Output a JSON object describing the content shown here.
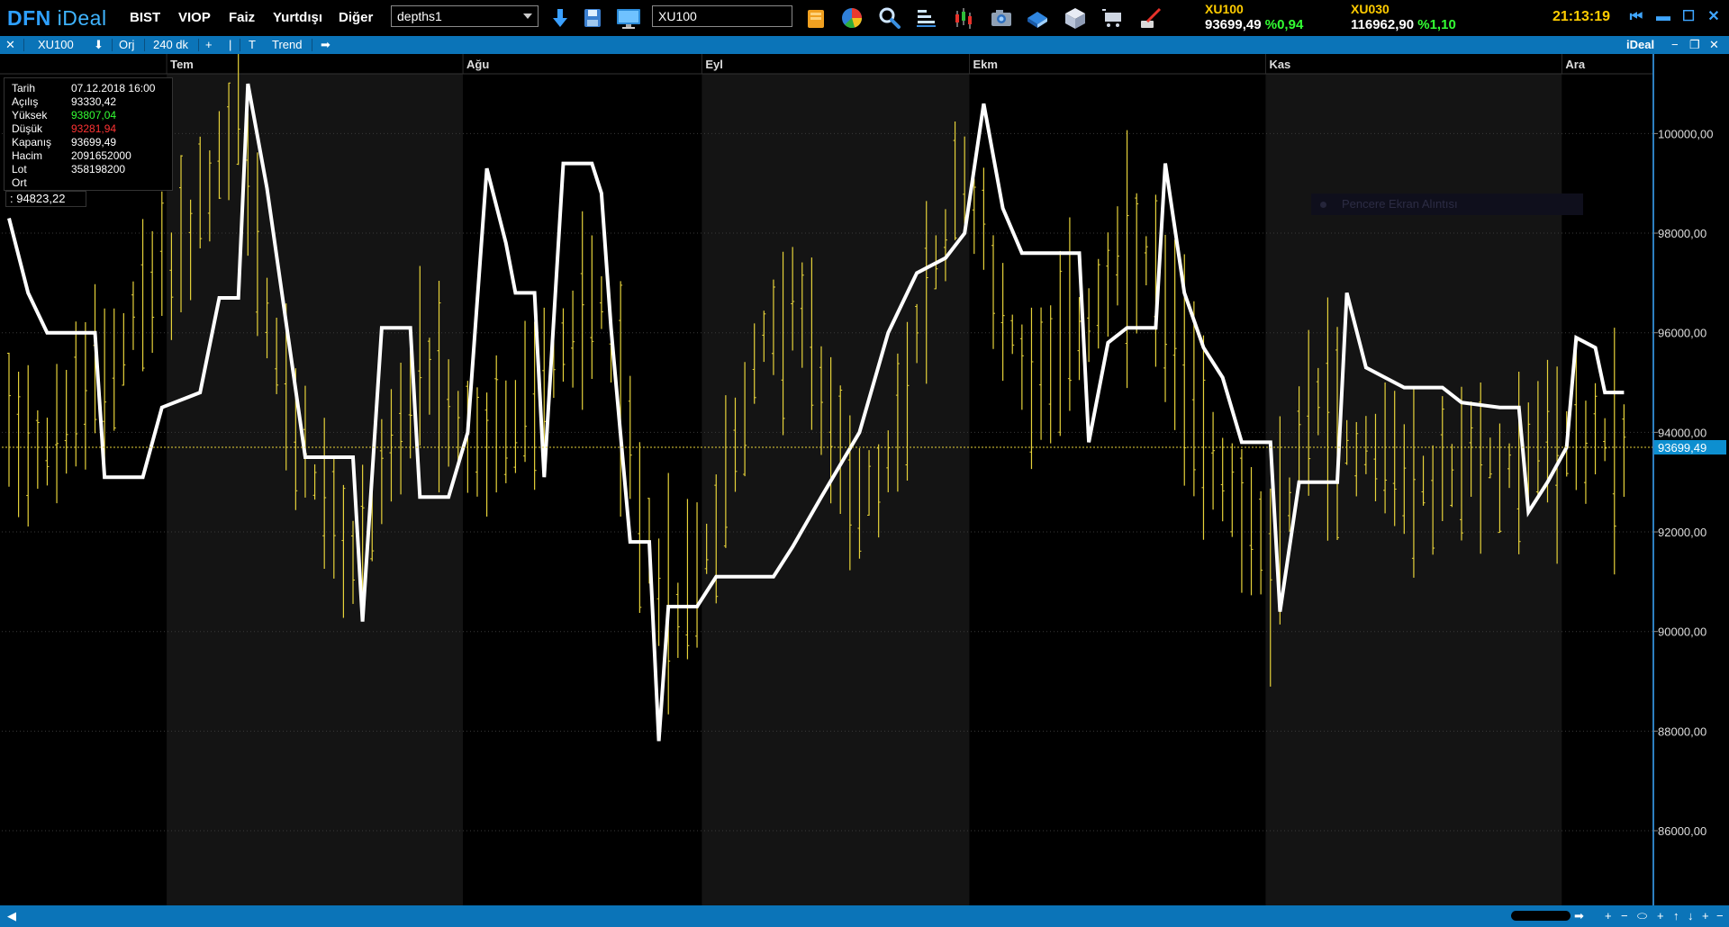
{
  "app": {
    "logo_main": "DFN",
    "logo_sub": "iDeal"
  },
  "menu": [
    {
      "id": "bist",
      "label": "BIST"
    },
    {
      "id": "viop",
      "label": "VIOP"
    },
    {
      "id": "faiz",
      "label": "Faiz"
    },
    {
      "id": "yurtdisi",
      "label": "Yurtdışı"
    },
    {
      "id": "diger",
      "label": "Diğer"
    }
  ],
  "toolbar": {
    "depth_select": "depths1",
    "symbol_input": "XU100"
  },
  "icons": [
    "download-arrow-icon",
    "save-disk-icon",
    "monitor-icon",
    "folder-icon",
    "pie-chart-icon",
    "magnifier-icon",
    "bar-list-icon",
    "candlestick-icon",
    "camera-icon",
    "book-icon",
    "cube-icon",
    "cart-icon",
    "brush-icon"
  ],
  "quotes": [
    {
      "name": "XU100",
      "value": "93699,49",
      "change": "%0,94"
    },
    {
      "name": "XU030",
      "value": "116962,90",
      "change": "%1,10"
    }
  ],
  "clock": "21:13:19",
  "chart_tab": {
    "symbol": "XU100",
    "mode": "Orj",
    "period": "240 dk",
    "tool": "Trend",
    "brand": "iDeal"
  },
  "info": {
    "rows": [
      {
        "label": "Tarih",
        "value": "07.12.2018 16:00",
        "color": "#ffffff"
      },
      {
        "label": "Açılış",
        "value": "93330,42",
        "color": "#ffffff"
      },
      {
        "label": "Yüksek",
        "value": "93807,04",
        "color": "#33ff33"
      },
      {
        "label": "Düşük",
        "value": "93281,94",
        "color": "#ff3333"
      },
      {
        "label": "Kapanış",
        "value": "93699,49",
        "color": "#ffffff"
      },
      {
        "label": "Hacim",
        "value": "2091652000",
        "color": "#ffffff"
      },
      {
        "label": "Lot",
        "value": "358198200",
        "color": "#ffffff"
      },
      {
        "label": "Ort",
        "value": "",
        "color": "#ffffff"
      }
    ],
    "indicator_value": ": 94823,22"
  },
  "ghost_tooltip": "Pencere Ekran Alıntısı",
  "colors": {
    "bar": "#e6d23a",
    "line": "#ffffff",
    "accent": "#0b74b8",
    "price_tag": "#0d8fd0"
  },
  "chart_data": {
    "type": "bar",
    "ylim": [
      84500,
      101200
    ],
    "y_ticks": [
      86000,
      88000,
      90000,
      92000,
      94000,
      96000,
      98000,
      100000
    ],
    "y_tick_labels": [
      "86000,00",
      "88000,00",
      "90000,00",
      "92000,00",
      "94000,00",
      "96000,00",
      "98000,00",
      "100000,00"
    ],
    "months": [
      {
        "label": "Tem",
        "start_bar": 17
      },
      {
        "label": "Ağu",
        "start_bar": 48
      },
      {
        "label": "Eyl",
        "start_bar": 73
      },
      {
        "label": "Ekm",
        "start_bar": 101
      },
      {
        "label": "Kas",
        "start_bar": 132
      },
      {
        "label": "Ara",
        "start_bar": 163
      }
    ],
    "last_close": 93699.49,
    "last_close_label": "93699,49",
    "bar_count": 170,
    "price_path": [
      [
        0,
        94500
      ],
      [
        4,
        93700
      ],
      [
        10,
        95200
      ],
      [
        14,
        96600
      ],
      [
        19,
        97900
      ],
      [
        24,
        100400
      ],
      [
        27,
        96200
      ],
      [
        30,
        94000
      ],
      [
        33,
        92500
      ],
      [
        36,
        91200
      ],
      [
        40,
        93800
      ],
      [
        44,
        94900
      ],
      [
        47,
        94000
      ],
      [
        50,
        93600
      ],
      [
        54,
        94300
      ],
      [
        58,
        95700
      ],
      [
        62,
        96800
      ],
      [
        66,
        92400
      ],
      [
        70,
        90200
      ],
      [
        74,
        92200
      ],
      [
        78,
        95400
      ],
      [
        82,
        96600
      ],
      [
        87,
        93500
      ],
      [
        91,
        92500
      ],
      [
        95,
        95800
      ],
      [
        100,
        99300
      ],
      [
        103,
        97100
      ],
      [
        106,
        95400
      ],
      [
        110,
        95700
      ],
      [
        114,
        96500
      ],
      [
        118,
        97700
      ],
      [
        121,
        96300
      ],
      [
        125,
        93900
      ],
      [
        129,
        92700
      ],
      [
        132,
        90700
      ],
      [
        136,
        94800
      ],
      [
        140,
        93800
      ],
      [
        144,
        93600
      ],
      [
        148,
        92800
      ],
      [
        152,
        93300
      ],
      [
        156,
        93400
      ],
      [
        160,
        93700
      ],
      [
        163,
        93900
      ],
      [
        167,
        93800
      ],
      [
        169,
        93700
      ]
    ],
    "indicator_line": [
      [
        0,
        98300
      ],
      [
        2,
        96800
      ],
      [
        4,
        96000
      ],
      [
        9,
        96000
      ],
      [
        10,
        93100
      ],
      [
        14,
        93100
      ],
      [
        16,
        94500
      ],
      [
        20,
        94800
      ],
      [
        22,
        96700
      ],
      [
        24,
        96700
      ],
      [
        25,
        101000
      ],
      [
        27,
        98900
      ],
      [
        31,
        93500
      ],
      [
        36,
        93500
      ],
      [
        37,
        90200
      ],
      [
        39,
        96100
      ],
      [
        42,
        96100
      ],
      [
        43,
        92700
      ],
      [
        46,
        92700
      ],
      [
        48,
        94000
      ],
      [
        50,
        99300
      ],
      [
        52,
        97800
      ],
      [
        53,
        96800
      ],
      [
        55,
        96800
      ],
      [
        56,
        93100
      ],
      [
        58,
        99400
      ],
      [
        61,
        99400
      ],
      [
        62,
        98800
      ],
      [
        63,
        96100
      ],
      [
        65,
        91800
      ],
      [
        67,
        91800
      ],
      [
        68,
        87800
      ],
      [
        69,
        90500
      ],
      [
        72,
        90500
      ],
      [
        74,
        91100
      ],
      [
        80,
        91100
      ],
      [
        82,
        91700
      ],
      [
        85,
        92700
      ],
      [
        89,
        94000
      ],
      [
        92,
        96000
      ],
      [
        95,
        97200
      ],
      [
        98,
        97500
      ],
      [
        100,
        98000
      ],
      [
        102,
        100600
      ],
      [
        104,
        98500
      ],
      [
        106,
        97600
      ],
      [
        112,
        97600
      ],
      [
        113,
        93800
      ],
      [
        115,
        95800
      ],
      [
        117,
        96100
      ],
      [
        120,
        96100
      ],
      [
        121,
        99400
      ],
      [
        123,
        96800
      ],
      [
        125,
        95700
      ],
      [
        127,
        95100
      ],
      [
        129,
        93800
      ],
      [
        132,
        93800
      ],
      [
        133,
        90400
      ],
      [
        135,
        93000
      ],
      [
        139,
        93000
      ],
      [
        140,
        96800
      ],
      [
        142,
        95300
      ],
      [
        146,
        94900
      ],
      [
        150,
        94900
      ],
      [
        152,
        94600
      ],
      [
        156,
        94500
      ],
      [
        158,
        94500
      ],
      [
        159,
        92400
      ],
      [
        161,
        93000
      ],
      [
        163,
        93700
      ],
      [
        164,
        95900
      ],
      [
        166,
        95700
      ],
      [
        167,
        94800
      ],
      [
        169,
        94800
      ]
    ]
  }
}
